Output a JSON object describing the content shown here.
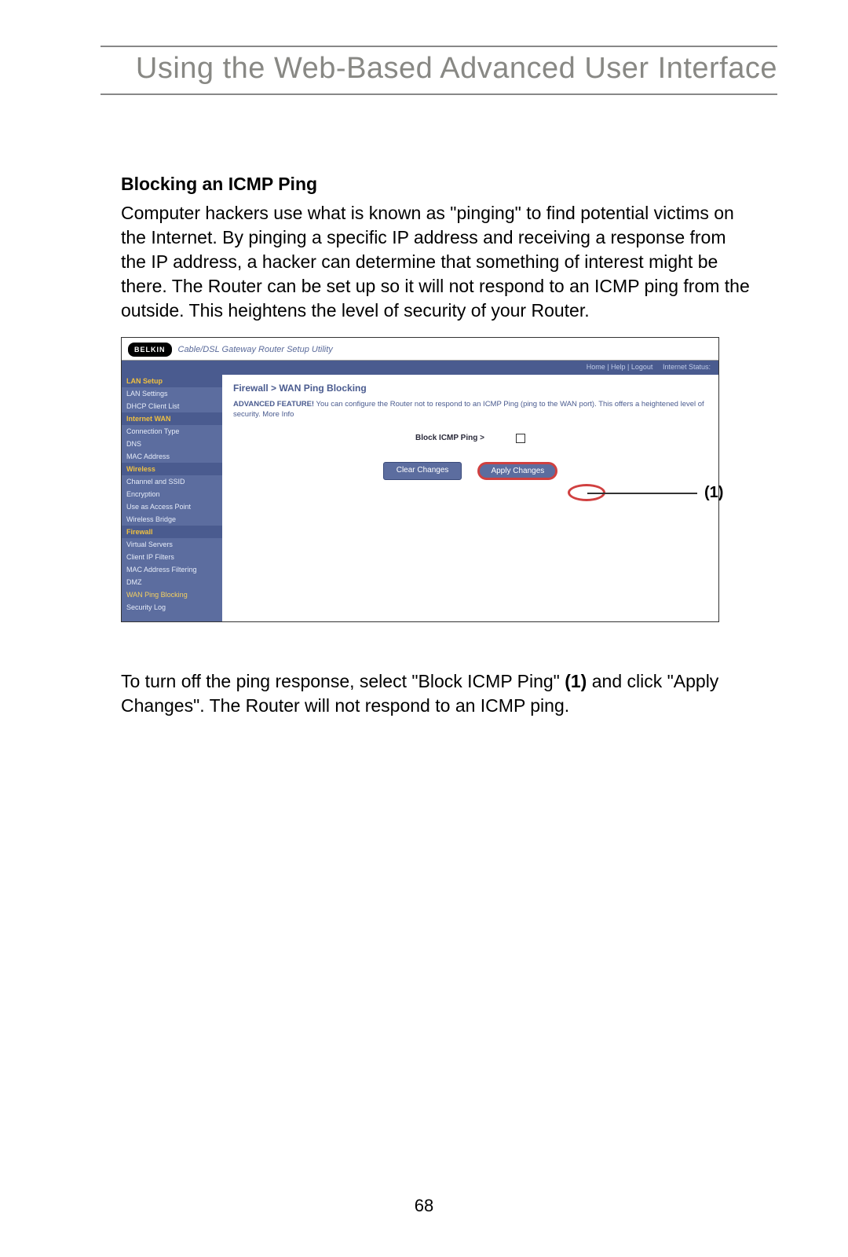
{
  "page": {
    "headerTitle": "Using the Web-Based Advanced User Interface",
    "sectionTitle": "Blocking an ICMP Ping",
    "paragraph1": "Computer hackers use what is known as \"pinging\" to find potential victims on the Internet. By pinging a specific IP address and receiving a response from the IP address, a hacker can determine that something of interest might be there. The Router can be set up so it will not respond to an ICMP ping from the outside. This heightens the level of security of your Router.",
    "paragraph2a": "To turn off the ping response, select \"Block ICMP Ping\" ",
    "paragraph2_bold": "(1)",
    "paragraph2b": " and click \"Apply Changes\". The Router will not respond to an ICMP ping.",
    "pageNumber": "68"
  },
  "ui": {
    "logo": "BELKIN",
    "utilityTitle": "Cable/DSL Gateway Router Setup Utility",
    "topbar": {
      "a": "Home | Help | Logout",
      "b": "Internet Status:"
    },
    "breadcrumb": "Firewall > WAN Ping Blocking",
    "featureLead": "ADVANCED FEATURE!",
    "featureBody": " You can configure the Router not to respond to an ICMP Ping (ping to the WAN port). This offers a heightened level of security. More Info",
    "checkboxLabel": "Block ICMP Ping >",
    "clearBtn": "Clear Changes",
    "applyBtn": "Apply Changes",
    "annotation": "(1)",
    "sidebar": {
      "sec1": "LAN Setup",
      "sec1Items": [
        "LAN Settings",
        "DHCP Client List"
      ],
      "sec2": "Internet WAN",
      "sec2Items": [
        "Connection Type",
        "DNS",
        "MAC Address"
      ],
      "sec3": "Wireless",
      "sec3Items": [
        "Channel and SSID",
        "Encryption",
        "Use as Access Point",
        "Wireless Bridge"
      ],
      "sec4": "Firewall",
      "sec4Items": [
        "Virtual Servers",
        "Client IP Filters",
        "MAC Address Filtering",
        "DMZ"
      ],
      "sec4Active": "WAN Ping Blocking",
      "sec4Items2": [
        "Security Log"
      ]
    }
  }
}
